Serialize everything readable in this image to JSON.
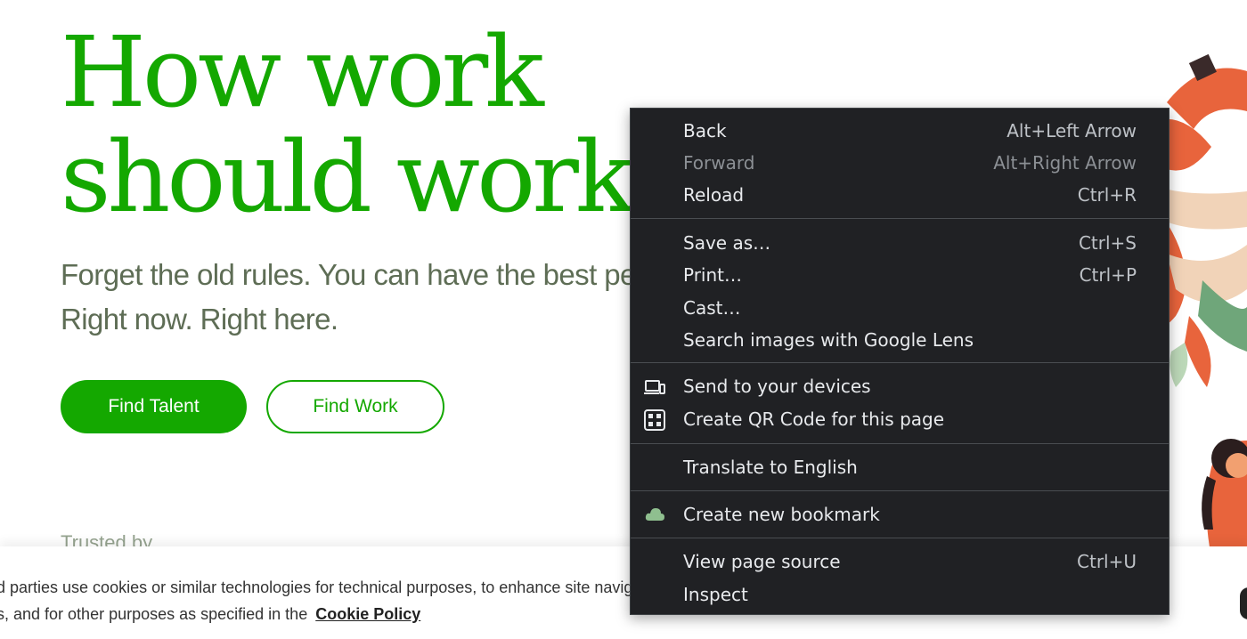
{
  "hero": {
    "title_line1": "How work",
    "title_line2": "should work",
    "subtitle_line1": "Forget the old rules. You can have the best people.",
    "subtitle_line2": "Right now. Right here.",
    "find_talent_label": "Find Talent",
    "find_work_label": "Find Work",
    "trusted_label": "Trusted by"
  },
  "cookie_banner": {
    "line1": "d parties use cookies or similar technologies for technical purposes, to enhance site navigation, analyze site usage, assist in our marketing efforts,",
    "line2_prefix": "s, and for other purposes as specified in the",
    "policy_link": "Cookie Policy"
  },
  "colors": {
    "brand_green": "#14a800",
    "menu_bg": "#202124",
    "menu_text": "#e8eaed",
    "menu_disabled": "#8c9095"
  },
  "context_menu": {
    "back": {
      "label": "Back",
      "shortcut": "Alt+Left Arrow"
    },
    "forward": {
      "label": "Forward",
      "shortcut": "Alt+Right Arrow"
    },
    "reload": {
      "label": "Reload",
      "shortcut": "Ctrl+R"
    },
    "save_as": {
      "label": "Save as…",
      "shortcut": "Ctrl+S"
    },
    "print": {
      "label": "Print…",
      "shortcut": "Ctrl+P"
    },
    "cast": {
      "label": "Cast…"
    },
    "search_lens": {
      "label": "Search images with Google Lens"
    },
    "send_devices": {
      "label": "Send to your devices",
      "icon": "devices-icon"
    },
    "qr_code": {
      "label": "Create QR Code for this page",
      "icon": "qr-code-icon"
    },
    "translate": {
      "label": "Translate to English"
    },
    "bookmark": {
      "label": "Create new bookmark",
      "icon": "cloud-icon"
    },
    "view_source": {
      "label": "View page source",
      "shortcut": "Ctrl+U"
    },
    "inspect": {
      "label": "Inspect"
    }
  }
}
